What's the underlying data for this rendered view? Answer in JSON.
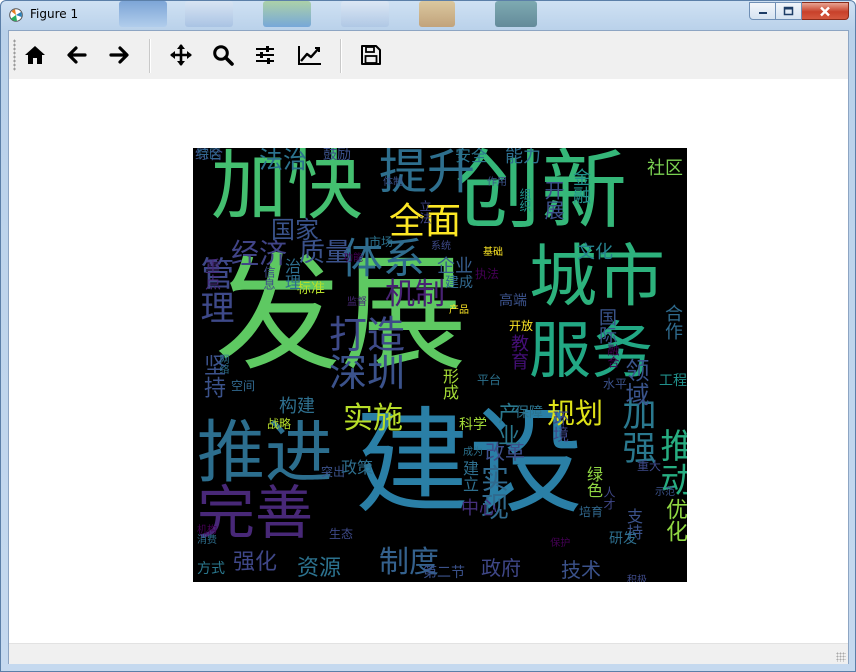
{
  "window": {
    "title": "Figure 1"
  },
  "toolbar": {
    "buttons": [
      {
        "name": "home-button",
        "icon": "home-icon"
      },
      {
        "name": "back-button",
        "icon": "arrow-left-icon"
      },
      {
        "name": "forward-button",
        "icon": "arrow-right-icon"
      },
      {
        "name": "pan-button",
        "icon": "move-icon"
      },
      {
        "name": "zoom-button",
        "icon": "magnifier-icon"
      },
      {
        "name": "configure-subplots-button",
        "icon": "sliders-icon"
      },
      {
        "name": "edit-axes-button",
        "icon": "line-chart-icon"
      },
      {
        "name": "save-button",
        "icon": "floppy-disk-icon"
      }
    ]
  },
  "wordcloud": {
    "background": "#000000",
    "palette": [
      "#5ec962",
      "#21918c",
      "#3b528b",
      "#440154",
      "#fde725",
      "#35b779",
      "#31688e",
      "#90d743"
    ],
    "words": [
      {
        "t": "发展",
        "c": "#5ec962"
      },
      {
        "t": "建设",
        "c": "#2a7fa6"
      },
      {
        "t": "创新",
        "c": "#35b779"
      },
      {
        "t": "加快",
        "c": "#44bf70"
      },
      {
        "t": "城市",
        "c": "#2db27d"
      },
      {
        "t": "推进",
        "c": "#2c6e8e"
      },
      {
        "t": "服务",
        "c": "#22a884"
      },
      {
        "t": "完善",
        "c": "#482878"
      },
      {
        "t": "提升",
        "c": "#2e6f8e"
      },
      {
        "t": "体系",
        "c": "#2f6c8e"
      },
      {
        "t": "全面",
        "c": "#fde725"
      },
      {
        "t": "打造",
        "c": "#3e4a89"
      },
      {
        "t": "深圳",
        "c": "#3b528b"
      },
      {
        "t": "机制",
        "c": "#482173"
      },
      {
        "t": "实施",
        "c": "#b8de29"
      },
      {
        "t": "加强",
        "c": "#2a788e"
      },
      {
        "t": "推动",
        "c": "#27ad81"
      },
      {
        "t": "规划",
        "c": "#dfe318"
      },
      {
        "t": "实现",
        "c": "#306a8e"
      },
      {
        "t": "制度",
        "c": "#34618d"
      },
      {
        "t": "管理",
        "c": "#3e4989"
      },
      {
        "t": "经济",
        "c": "#414487"
      },
      {
        "t": "质量",
        "c": "#3b528b"
      },
      {
        "t": "法治",
        "c": "#2c738e"
      },
      {
        "t": "国家",
        "c": "#3a538b"
      },
      {
        "t": "能力",
        "c": "#2e6e8e"
      },
      {
        "t": "安全",
        "c": "#2b748e"
      },
      {
        "t": "社区",
        "c": "#7ad151"
      },
      {
        "t": "文化",
        "c": "#26828e"
      },
      {
        "t": "改革",
        "c": "#3d4e8a"
      },
      {
        "t": "教育",
        "c": "#440f76"
      },
      {
        "t": "产业",
        "c": "#2a788e"
      },
      {
        "t": "领域",
        "c": "#3a548c"
      },
      {
        "t": "资源",
        "c": "#2c728e"
      },
      {
        "t": "政府",
        "c": "#3f4788"
      },
      {
        "t": "技术",
        "c": "#3b528b"
      },
      {
        "t": "中心",
        "c": "#46307e"
      },
      {
        "t": "强化",
        "c": "#3f4788"
      },
      {
        "t": "方式",
        "c": "#2a788e"
      },
      {
        "t": "构建",
        "c": "#2e6f8e"
      },
      {
        "t": "战略",
        "c": "#b5de2b"
      },
      {
        "t": "企业",
        "c": "#365d8d"
      },
      {
        "t": "重点",
        "c": "#472c7a"
      },
      {
        "t": "坚持",
        "c": "#3b528b"
      },
      {
        "t": "科学",
        "c": "#a2da37"
      },
      {
        "t": "政策",
        "c": "#2e6f8e"
      },
      {
        "t": "第二节",
        "c": "#3b528b"
      },
      {
        "t": "开展",
        "c": "#3c4f8a"
      },
      {
        "t": "国际",
        "c": "#3a548c"
      },
      {
        "t": "环境",
        "c": "#3f4788"
      },
      {
        "t": "建立",
        "c": "#2e6f8e"
      },
      {
        "t": "优化",
        "c": "#90d743"
      },
      {
        "t": "支持",
        "c": "#3b528b"
      },
      {
        "t": "合作",
        "c": "#2f6b8e"
      },
      {
        "t": "建成",
        "c": "#31688e"
      },
      {
        "t": "执法",
        "c": "#440154"
      },
      {
        "t": "高端",
        "c": "#3b528b"
      },
      {
        "t": "开放",
        "c": "#fde725"
      },
      {
        "t": "形成",
        "c": "#a5db36"
      },
      {
        "t": "保障",
        "c": "#2c738e"
      },
      {
        "t": "生态",
        "c": "#3e4a89"
      },
      {
        "t": "研发",
        "c": "#2e6f8e"
      },
      {
        "t": "工程",
        "c": "#21918c"
      },
      {
        "t": "水平",
        "c": "#3b528b"
      },
      {
        "t": "标准",
        "c": "#b5de2b"
      },
      {
        "t": "平台",
        "c": "#2c728e"
      },
      {
        "t": "鼓励",
        "c": "#3b528b"
      },
      {
        "t": "市场",
        "c": "#2c728e"
      },
      {
        "t": "立法",
        "c": "#414487"
      },
      {
        "t": "重大",
        "c": "#3e4a89"
      },
      {
        "t": "治理",
        "c": "#2e6e8e"
      },
      {
        "t": "金融",
        "c": "#21918c"
      },
      {
        "t": "基础",
        "c": "#fde725"
      },
      {
        "t": "绿色",
        "c": "#90d743"
      },
      {
        "t": "培育",
        "c": "#31688e"
      },
      {
        "t": "综合",
        "c": "#3b528b"
      },
      {
        "t": "功能",
        "c": "#440154"
      },
      {
        "t": "组织",
        "c": "#21918c"
      },
      {
        "t": "人才",
        "c": "#3f4788"
      },
      {
        "t": "示范",
        "c": "#3b528b"
      },
      {
        "t": "空间",
        "c": "#31688e"
      },
      {
        "t": "网络",
        "c": "#2c728e"
      },
      {
        "t": "融合",
        "c": "#440154"
      },
      {
        "t": "信息",
        "c": "#3e4a89"
      },
      {
        "t": "消费",
        "c": "#2e6f8e"
      },
      {
        "t": "突出",
        "c": "#3b528b"
      },
      {
        "t": "监督",
        "c": "#482878"
      },
      {
        "t": "产品",
        "c": "#fde725"
      },
      {
        "t": "积极",
        "c": "#3e4a89"
      },
      {
        "t": "成为",
        "c": "#2c728e"
      },
      {
        "t": "机构",
        "c": "#440154"
      },
      {
        "t": "体制",
        "c": "#3b528b"
      },
      {
        "t": "特区",
        "c": "#31688e"
      },
      {
        "t": "作用",
        "c": "#3b528b"
      },
      {
        "t": "系统",
        "c": "#3e4a89"
      },
      {
        "t": "保护",
        "c": "#440154"
      }
    ]
  }
}
